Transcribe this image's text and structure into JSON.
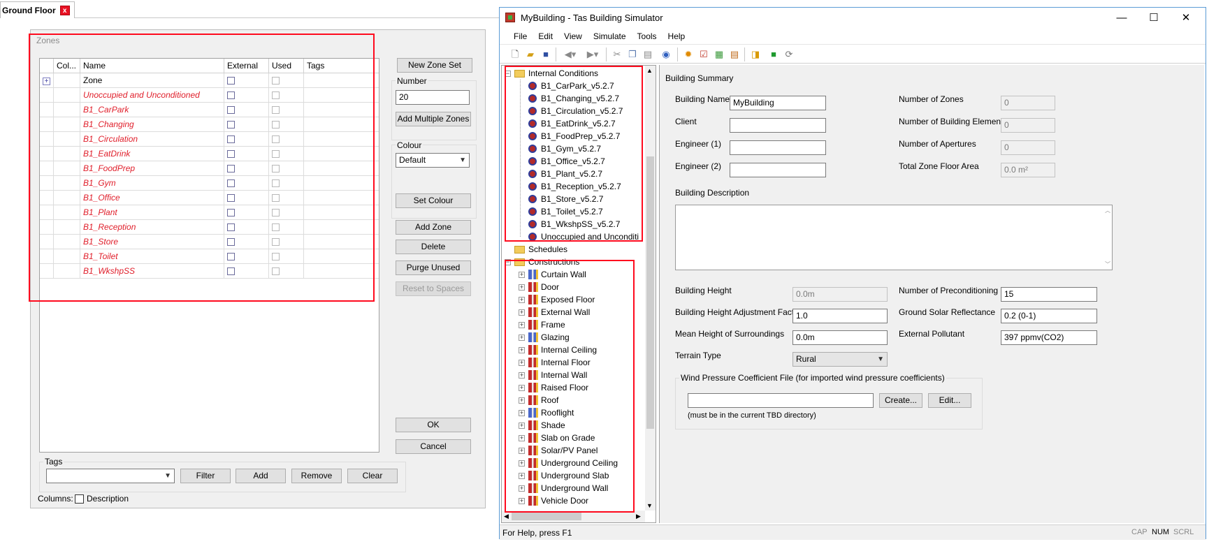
{
  "ground_floor_tab": {
    "label": "Ground Floor",
    "close": "x"
  },
  "zones_dialog": {
    "group_title": "Zones",
    "columns": {
      "col": "Col...",
      "name": "Name",
      "external": "External",
      "used": "Used",
      "tags": "Tags"
    },
    "header_row": "Zone",
    "expander": "+",
    "zones": [
      "Unoccupied and Unconditioned",
      "B1_CarPark",
      "B1_Changing",
      "B1_Circulation",
      "B1_EatDrink",
      "B1_FoodPrep",
      "B1_Gym",
      "B1_Office",
      "B1_Plant",
      "B1_Reception",
      "B1_Store",
      "B1_Toilet",
      "B1_WkshpSS"
    ],
    "buttons": {
      "new_zone_set": "New Zone Set",
      "number_label": "Number",
      "number_value": "20",
      "add_multiple": "Add Multiple Zones",
      "colour_label": "Colour",
      "colour_value": "Default",
      "set_colour": "Set Colour",
      "add_zone": "Add Zone",
      "delete": "Delete",
      "purge_unused": "Purge Unused",
      "reset_to_spaces": "Reset to Spaces",
      "ok": "OK",
      "cancel": "Cancel"
    },
    "tags_group": {
      "label": "Tags",
      "filter": "Filter",
      "add": "Add",
      "remove": "Remove",
      "clear": "Clear"
    },
    "columns_label": "Columns:",
    "description_label": "Description"
  },
  "bsim": {
    "title": "MyBuilding - Tas Building Simulator",
    "window_controls": {
      "minimize": "—",
      "maximize": "☐",
      "close": "✕"
    },
    "menu": [
      "File",
      "Edit",
      "View",
      "Simulate",
      "Tools",
      "Help"
    ],
    "tree": {
      "internal_conditions": "Internal Conditions",
      "ic_items": [
        "B1_CarPark_v5.2.7",
        "B1_Changing_v5.2.7",
        "B1_Circulation_v5.2.7",
        "B1_EatDrink_v5.2.7",
        "B1_FoodPrep_v5.2.7",
        "B1_Gym_v5.2.7",
        "B1_Office_v5.2.7",
        "B1_Plant_v5.2.7",
        "B1_Reception_v5.2.7",
        "B1_Store_v5.2.7",
        "B1_Toilet_v5.2.7",
        "B1_WkshpSS_v5.2.7",
        "Unoccupied and Unconditi"
      ],
      "schedules": "Schedules",
      "constructions": "Constructions",
      "construction_items": [
        "Curtain Wall",
        "Door",
        "Exposed Floor",
        "External Wall",
        "Frame",
        "Glazing",
        "Internal Ceiling",
        "Internal Floor",
        "Internal Wall",
        "Raised Floor",
        "Roof",
        "Rooflight",
        "Shade",
        "Slab on Grade",
        "Solar/PV Panel",
        "Underground Ceiling",
        "Underground Slab",
        "Underground Wall",
        "Vehicle Door"
      ]
    },
    "summary": {
      "heading": "Building Summary",
      "building_name_label": "Building Name",
      "building_name": "MyBuilding",
      "client_label": "Client",
      "engineer1_label": "Engineer (1)",
      "engineer2_label": "Engineer (2)",
      "num_zones_label": "Number of Zones",
      "num_zones": "0",
      "num_elements_label": "Number of Building Elements",
      "num_elements": "0",
      "num_apertures_label": "Number of Apertures",
      "num_apertures": "0",
      "floor_area_label": "Total Zone Floor Area",
      "floor_area": "0.0 m²",
      "description_label": "Building Description",
      "height_label": "Building Height",
      "height": "0.0m",
      "height_adj_label": "Building Height Adjustment Factor",
      "height_adj": "1.0",
      "mean_height_label": "Mean Height of Surroundings",
      "mean_height": "0.0m",
      "terrain_label": "Terrain Type",
      "terrain": "Rural",
      "precond_label": "Number of Preconditioning Days",
      "precond": "15",
      "solar_refl_label": "Ground Solar Reflectance",
      "solar_refl": "0.2 (0-1)",
      "pollutant_label": "External Pollutant",
      "pollutant": "397 ppmv(CO2)",
      "wind_group_label": "Wind Pressure Coefficient File (for imported wind pressure coefficients)",
      "create": "Create...",
      "edit": "Edit...",
      "wind_note": "(must be in the current TBD directory)"
    },
    "status": {
      "help": "For Help, press F1",
      "cap": "CAP",
      "num": "NUM",
      "scrl": "SCRL"
    }
  },
  "colors": {
    "annotation": "#ff0a1e",
    "zone_text": "#e01e2a",
    "window_border": "#5b9bd5"
  }
}
